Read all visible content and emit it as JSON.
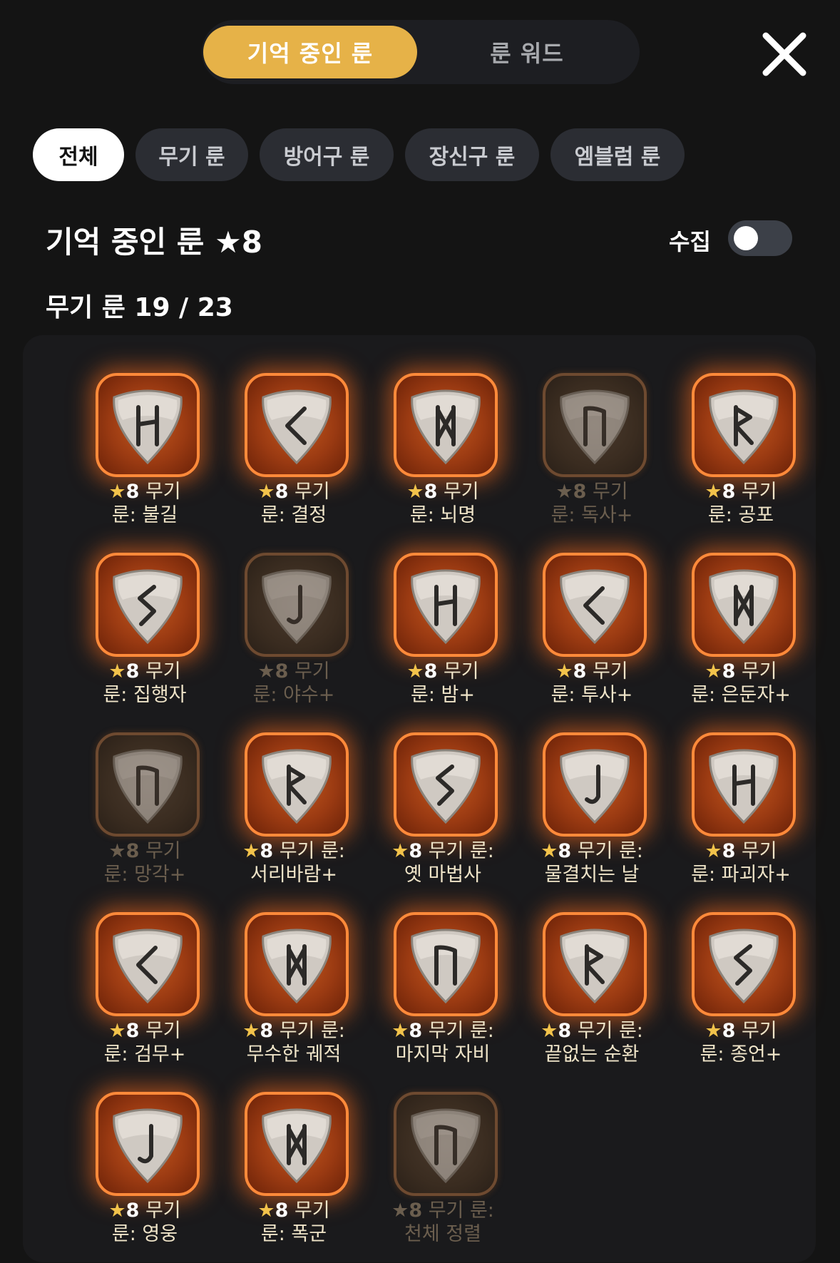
{
  "tabs": [
    {
      "label": "기억 중인 룬",
      "active": true
    },
    {
      "label": "룬 워드",
      "active": false
    }
  ],
  "filters": [
    {
      "label": "전체",
      "active": true
    },
    {
      "label": "무기 룬",
      "active": false
    },
    {
      "label": "방어구 룬",
      "active": false
    },
    {
      "label": "장신구 룬",
      "active": false
    },
    {
      "label": "엠블럼 룬",
      "active": false
    }
  ],
  "section_title": "기억 중인 룬 ★8",
  "collect_label": "수집",
  "collect_toggle_on": false,
  "count_title": "무기 룬  19 / 23",
  "colors": {
    "accent": "#e6b248",
    "rune_glow": "#ff8a3a",
    "star": "#f3c34b"
  },
  "runes": [
    {
      "line1": "무기",
      "line2": "룬: 불길",
      "glyph": "H",
      "owned": true
    },
    {
      "line1": "무기",
      "line2": "룬: 결정",
      "glyph": "<",
      "owned": true
    },
    {
      "line1": "무기",
      "line2": "룬: 뇌명",
      "glyph": "M",
      "owned": true
    },
    {
      "line1": "무기",
      "line2": "룬: 독사+",
      "glyph": "N",
      "owned": false
    },
    {
      "line1": "무기",
      "line2": "룬: 공포",
      "glyph": "R",
      "owned": true
    },
    {
      "line1": "무기",
      "line2": "룬: 집행자",
      "glyph": "S",
      "owned": true
    },
    {
      "line1": "무기",
      "line2": "룬: 야수+",
      "glyph": "J",
      "owned": false
    },
    {
      "line1": "무기",
      "line2": "룬: 밤+",
      "glyph": "H",
      "owned": true
    },
    {
      "line1": "무기",
      "line2": "룬: 투사+",
      "glyph": "<",
      "owned": true
    },
    {
      "line1": "무기",
      "line2": "룬: 은둔자+",
      "glyph": "M",
      "owned": true
    },
    {
      "line1": "무기",
      "line2": "룬: 망각+",
      "glyph": "N",
      "owned": false
    },
    {
      "line1": "무기 룬:",
      "line2": "서리바람+",
      "glyph": "R",
      "owned": true
    },
    {
      "line1": "무기 룬:",
      "line2": "옛 마법사",
      "glyph": "S",
      "owned": true
    },
    {
      "line1": "무기 룬:",
      "line2": "물결치는 날",
      "glyph": "J",
      "owned": true
    },
    {
      "line1": "무기",
      "line2": "룬: 파괴자+",
      "glyph": "H",
      "owned": true
    },
    {
      "line1": "무기",
      "line2": "룬: 검무+",
      "glyph": "<",
      "owned": true
    },
    {
      "line1": "무기 룬:",
      "line2": "무수한 궤적",
      "glyph": "M",
      "owned": true
    },
    {
      "line1": "무기 룬:",
      "line2": "마지막 자비",
      "glyph": "N",
      "owned": true
    },
    {
      "line1": "무기 룬:",
      "line2": "끝없는 순환",
      "glyph": "R",
      "owned": true
    },
    {
      "line1": "무기",
      "line2": "룬: 종언+",
      "glyph": "S",
      "owned": true
    },
    {
      "line1": "무기",
      "line2": "룬: 영웅",
      "glyph": "J",
      "owned": true
    },
    {
      "line1": "무기",
      "line2": "룬: 폭군",
      "glyph": "M",
      "owned": true
    },
    {
      "line1": "무기 룬:",
      "line2": "천체 정렬",
      "glyph": "N",
      "owned": false
    }
  ],
  "star_level": "8"
}
